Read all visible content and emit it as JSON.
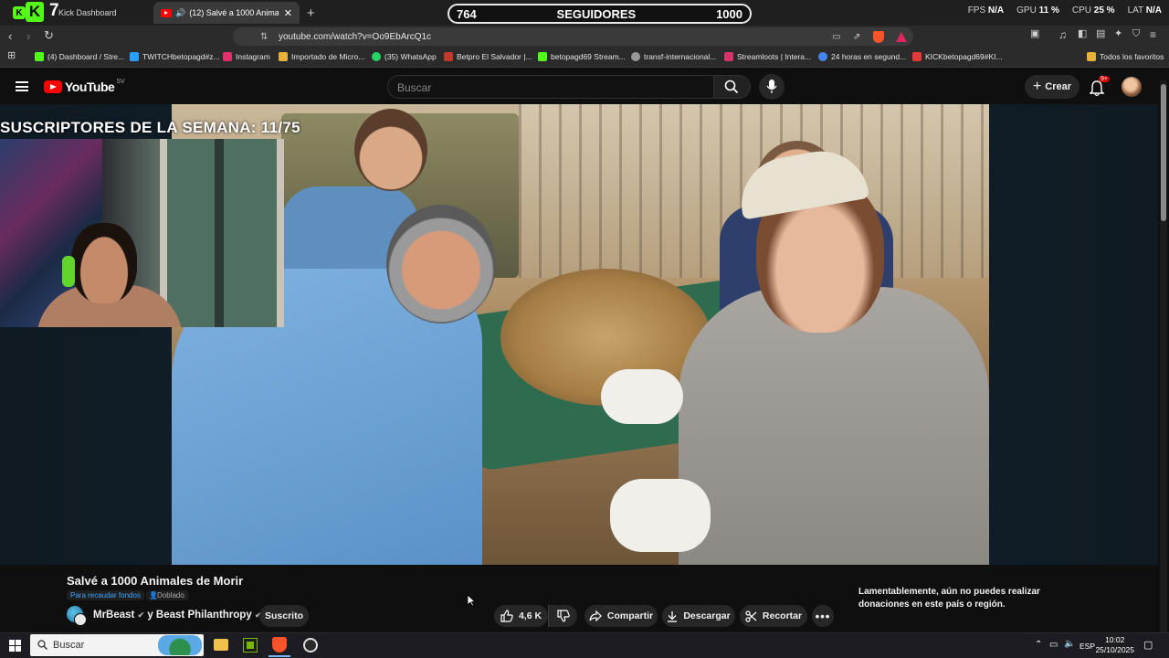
{
  "browser": {
    "tabs": [
      {
        "label": "Kick Dashboard",
        "active": false
      },
      {
        "label": "(12) Salvé a 1000 Animales de Morir",
        "active": true
      }
    ],
    "new_tab_icon": "plus-icon",
    "url": "youtube.com/watch?v=Oo9EbArcQ1c",
    "bookmarks": [
      {
        "label": "(4) Dashboard / Stre...",
        "color": "#53fc18"
      },
      {
        "label": "TWITCHbetopagd#z...",
        "color": "#29a0ff"
      },
      {
        "label": "Instagram",
        "color": "#e1306c"
      },
      {
        "label": "Importado de Micro...",
        "color": "#e8b23a"
      },
      {
        "label": "(35) WhatsApp",
        "color": "#25d366"
      },
      {
        "label": "Betpro El Salvador |...",
        "color": "#c0392b"
      },
      {
        "label": "betopagd69 Stream...",
        "color": "#53fc18"
      },
      {
        "label": "transf-internacional...",
        "color": "#999999"
      },
      {
        "label": "Streamloots | Intera...",
        "color": "#d6336c"
      },
      {
        "label": "24 horas en segund...",
        "color": "#4285f4"
      },
      {
        "label": "KICKbetopagd69#KI...",
        "color": "#e53935"
      }
    ],
    "all_bookmarks": "Todos los favoritos"
  },
  "stream_overlay": {
    "kick_count": "7",
    "followers_current": "764",
    "followers_label": "SEGUIDORES",
    "followers_goal": "1000",
    "stats": {
      "fps_label": "FPS",
      "fps_value": "N/A",
      "gpu_label": "GPU",
      "gpu_value": "11 %",
      "cpu_label": "CPU",
      "cpu_value": "25 %",
      "lat_label": "LAT",
      "lat_value": "N/A"
    },
    "subs_text": "SUSCRIPTORES DE LA SEMANA: 11/75"
  },
  "youtube": {
    "logo_text": "YouTube",
    "region": "SV",
    "search_placeholder": "Buscar",
    "create_label": "Crear",
    "notification_badge": "9+",
    "video": {
      "title": "Salvé a 1000 Animales de Morir",
      "fundraiser_chip": "Para recaudar fondos",
      "dubbed_chip": "Doblado",
      "channel": "MrBeast",
      "channel_joiner": "y Beast Philanthropy",
      "subscribed_label": "Suscrito",
      "likes": "4,6 K",
      "share_label": "Compartir",
      "download_label": "Descargar",
      "clip_label": "Recortar",
      "donation_notice": "Lamentablemente, aún no puedes realizar donaciones en este país o región."
    }
  },
  "taskbar": {
    "search_placeholder": "Buscar",
    "language": "ESP",
    "time": "10:02",
    "date": "25/10/2025"
  },
  "colors": {
    "youtube_red": "#ff0000",
    "kick_green": "#53fc18",
    "background": "#0f0f0f"
  }
}
